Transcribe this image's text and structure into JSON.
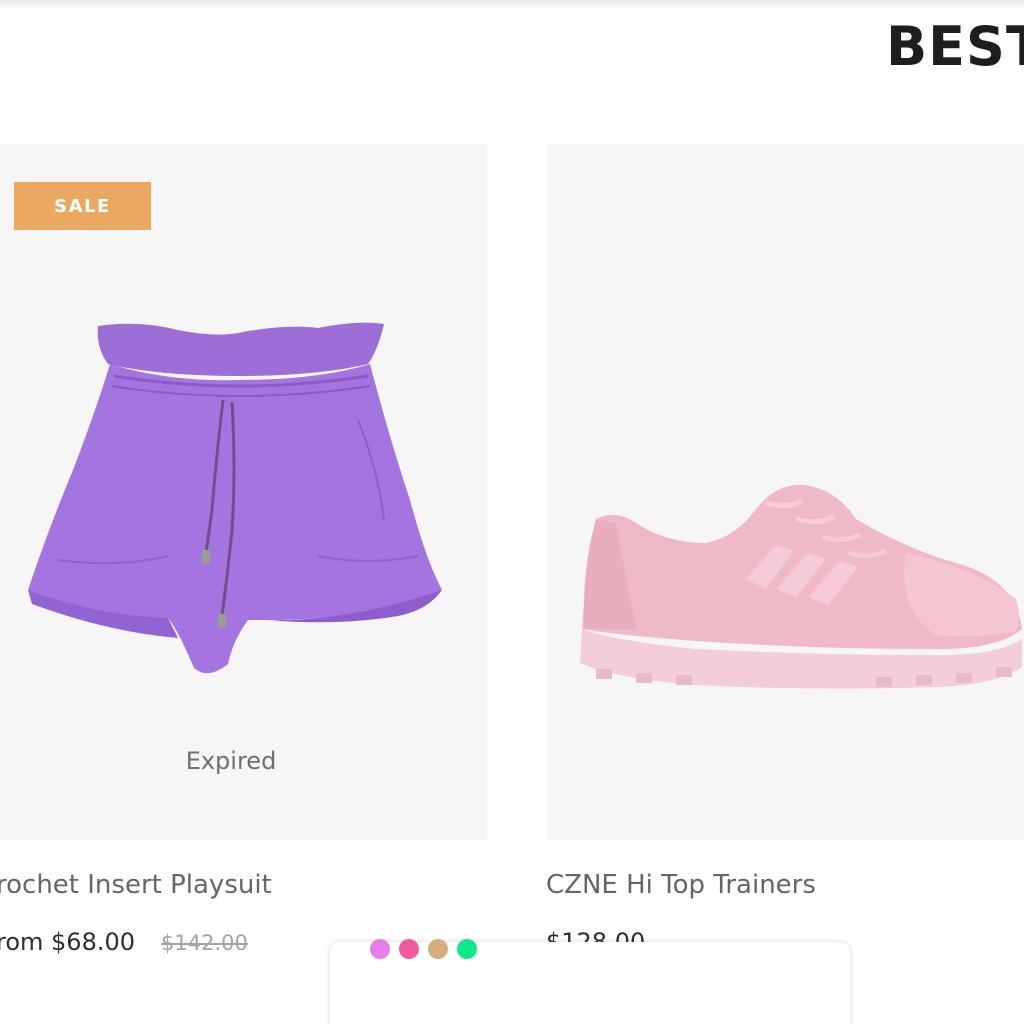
{
  "section": {
    "title": "BEST"
  },
  "products": [
    {
      "name": "rochet Insert Playsuit",
      "badge": "SALE",
      "status": "Expired",
      "price": "rom $68.00",
      "compare_price": "$142.00",
      "image": "purple-paperbag-shorts",
      "badge_color": "#eba860"
    },
    {
      "name": "CZNE Hi Top Trainers",
      "price": "$128.00",
      "image": "pink-suede-sneaker"
    }
  ],
  "swatches": [
    {
      "name": "violet",
      "color": "#e87ee8"
    },
    {
      "name": "pink",
      "color": "#f25a9e"
    },
    {
      "name": "tan",
      "color": "#d6ae7e"
    },
    {
      "name": "green",
      "color": "#0ee886"
    }
  ]
}
